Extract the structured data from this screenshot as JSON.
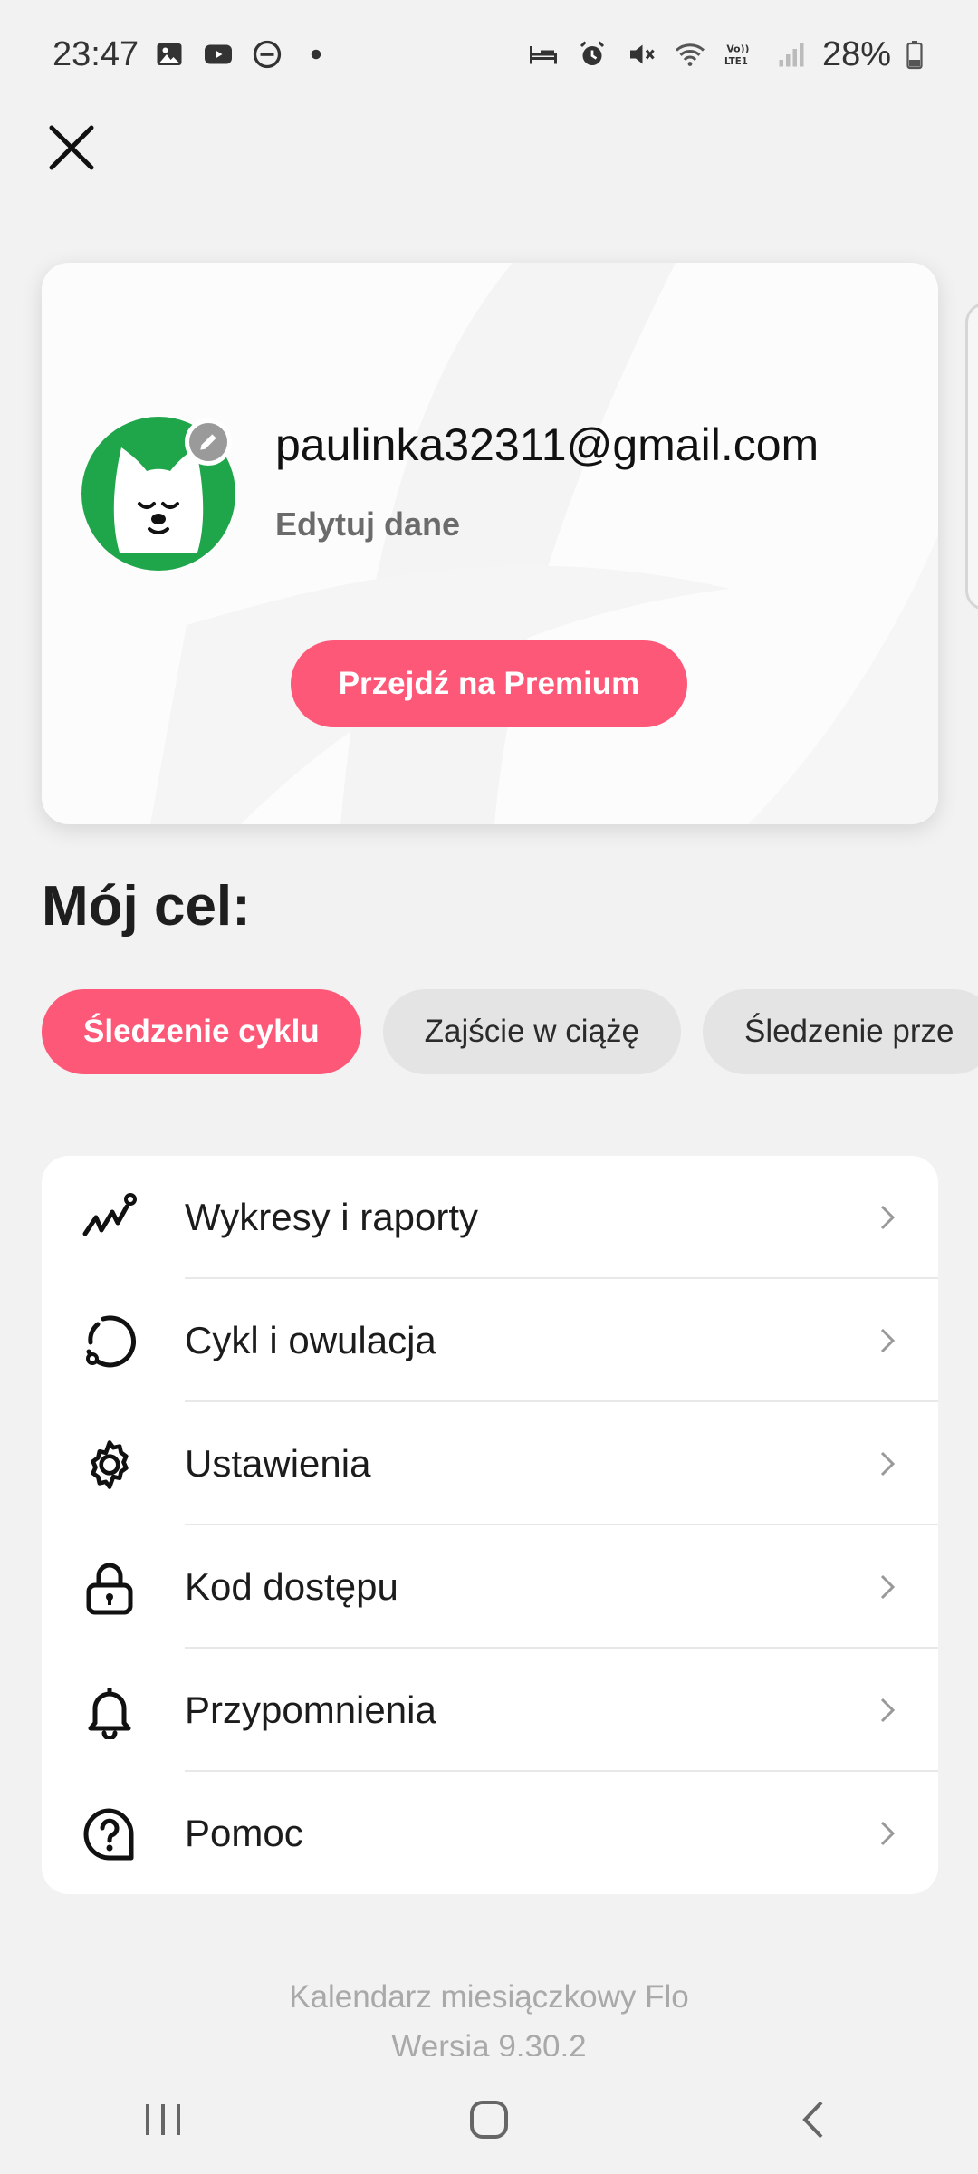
{
  "status_bar": {
    "time": "23:47",
    "battery": "28%",
    "icons_left": [
      "image-icon",
      "youtube-icon",
      "dnd-icon",
      "dot-icon"
    ],
    "icons_right": [
      "bed-icon",
      "alarm-icon",
      "mute-icon",
      "wifi-icon",
      "volte-icon",
      "signal-icon",
      "battery-icon"
    ],
    "volte_label": "Vo)) LTE1"
  },
  "profile": {
    "email": "paulinka32311@gmail.com",
    "edit_label": "Edytuj dane",
    "premium_button": "Przejdź na Premium"
  },
  "goal": {
    "title": "Mój cel:",
    "chips": [
      {
        "label": "Śledzenie cyklu",
        "active": true
      },
      {
        "label": "Zajście w ciążę",
        "active": false
      },
      {
        "label": "Śledzenie prze",
        "active": false
      }
    ]
  },
  "menu": {
    "items": [
      {
        "label": "Wykresy i raporty",
        "icon": "chart-icon"
      },
      {
        "label": "Cykl i owulacja",
        "icon": "cycle-icon"
      },
      {
        "label": "Ustawienia",
        "icon": "gear-icon"
      },
      {
        "label": "Kod dostępu",
        "icon": "lock-icon"
      },
      {
        "label": "Przypomnienia",
        "icon": "bell-icon"
      },
      {
        "label": "Pomoc",
        "icon": "help-icon"
      }
    ]
  },
  "footer": {
    "app_name": "Kalendarz miesiączkowy Flo",
    "version": "Wersja 9.30.2"
  },
  "colors": {
    "accent": "#fd5878",
    "avatar_bg": "#1fa64a",
    "background": "#f2f2f2"
  }
}
